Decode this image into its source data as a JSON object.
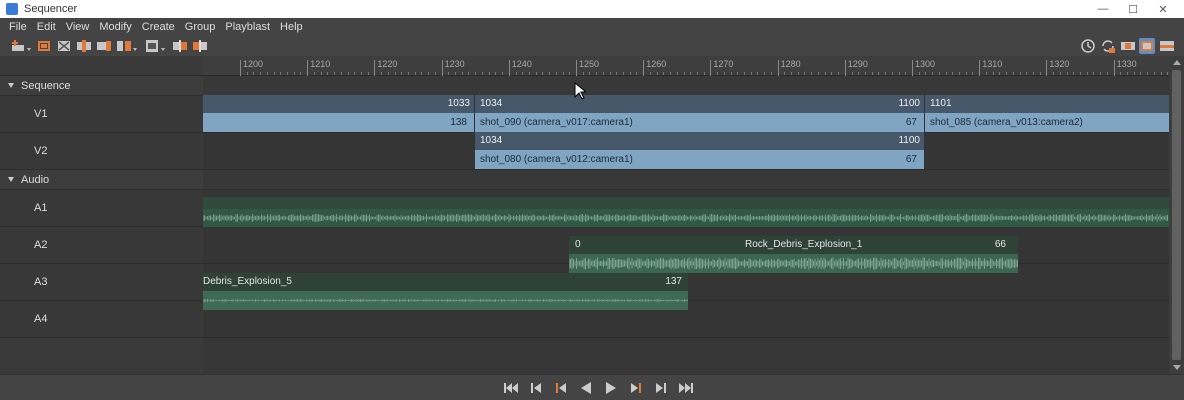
{
  "window": {
    "title": "Sequencer",
    "minimize_glyph": "—",
    "maximize_glyph": "☐",
    "close_glyph": "✕"
  },
  "menu": [
    "File",
    "Edit",
    "View",
    "Modify",
    "Create",
    "Group",
    "Playblast",
    "Help"
  ],
  "toolbar": {
    "left_icons": [
      "create-shot-icon",
      "frame-all-icon",
      "frame-selected-icon",
      "split-shot-icon",
      "shot-insert-icon",
      "shot-append-icon",
      "shot-swap-icon",
      "track-display-icon",
      "ripple-left-icon",
      "ripple-right-icon"
    ],
    "right_icons": [
      "history-icon",
      "refresh-icon",
      "sequence-view-icon",
      "shot-view-icon",
      "mixed-view-icon"
    ]
  },
  "ruler": {
    "labels": [
      "1200",
      "1210",
      "1220",
      "1230",
      "1240",
      "1250",
      "1260",
      "1270",
      "1280",
      "1290",
      "1300",
      "1310",
      "1320",
      "1330"
    ]
  },
  "groups": {
    "sequence": "Sequence",
    "audio": "Audio"
  },
  "tracks": {
    "v1": "V1",
    "v2": "V2",
    "a1": "A1",
    "a2": "A2",
    "a3": "A3",
    "a4": "A4"
  },
  "clips": {
    "v1_a": {
      "end": "1033",
      "duration": "138"
    },
    "v1_b": {
      "start": "1034",
      "end": "1100",
      "name": "shot_090 (camera_v017:camera1)",
      "duration": "67"
    },
    "v1_c": {
      "start": "1101",
      "name": "shot_085 (camera_v013:camera2)"
    },
    "v2_a": {
      "start": "1034",
      "end": "1100",
      "name": "shot_080 (camera_v012:camera1)",
      "duration": "67"
    },
    "a2_a": {
      "start": "0",
      "name": "Rock_Debris_Explosion_1",
      "end": "66"
    },
    "a3_a": {
      "name": "Debris_Explosion_5",
      "end": "137"
    }
  },
  "transport": [
    "go-to-start-icon",
    "step-back-key-icon",
    "step-back-frame-icon",
    "play-backward-icon",
    "play-forward-icon",
    "step-forward-frame-icon",
    "step-forward-key-icon",
    "go-to-end-icon"
  ],
  "colors": {
    "accent_orange": "#e07a3a",
    "video_clip": "#7fa5c3",
    "audio_clip": "#3f6b56"
  }
}
